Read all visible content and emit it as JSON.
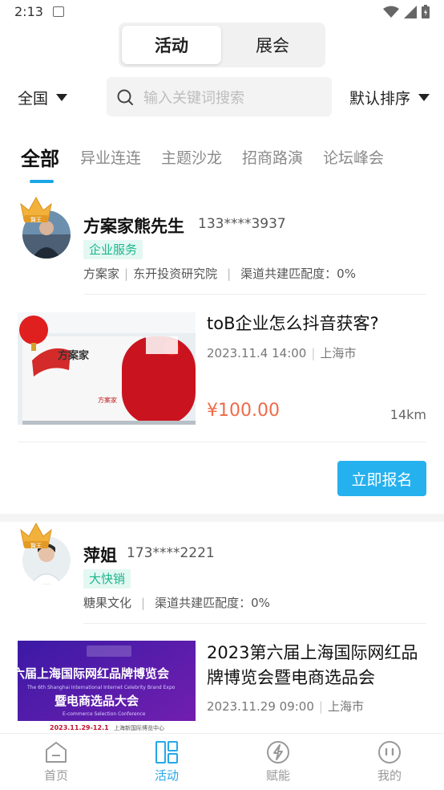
{
  "status_bar": {
    "time": "2:13"
  },
  "header": {
    "segments": [
      "活动",
      "展会"
    ],
    "region": "全国",
    "search_placeholder": "输入关键词搜索",
    "sort": "默认排序",
    "tabs": [
      "全部",
      "异业连连",
      "主题沙龙",
      "招商路演",
      "论坛峰会"
    ]
  },
  "crown_text": "賢王",
  "cards": [
    {
      "user_name": "方案家熊先生",
      "phone": "133****3937",
      "tag": "企业服务",
      "org1": "方案家",
      "org2": "东开投资研究院",
      "match": "渠道共建匹配度：0%",
      "event_title": "toB企业怎么抖音获客?",
      "event_date": "2023.11.4 14:00",
      "event_city": "上海市",
      "price": "¥100.00",
      "distance": "14km",
      "signup": "立即报名",
      "thumb_logo": "方案家",
      "thumb_caption": "方案家"
    },
    {
      "user_name": "萍姐",
      "phone": "173****2221",
      "tag": "大快销",
      "org1": "糖果文化",
      "match": "渠道共建匹配度：0%",
      "event_title": "2023第六届上海国际网红品牌博览会暨电商选品会",
      "event_date": "2023.11.29 09:00",
      "event_city": "上海市",
      "poster_line1": "六届上海国际网红品牌博览会",
      "poster_line2": "The 6th Shanghai International Internet Celebrity Brand Expo",
      "poster_line3": "暨电商选品大会",
      "poster_line4": "E-commerce Selection Conference",
      "poster_line5": "2023.11.29-12.1",
      "poster_line6": "上海新国际博览中心"
    }
  ],
  "bottom_nav": [
    "首页",
    "活动",
    "赋能",
    "我的"
  ],
  "colors": {
    "accent": "#25b1ee",
    "price": "#ef6a4a",
    "tag_bg": "#e3f8f2",
    "tag_fg": "#1bb58b"
  }
}
